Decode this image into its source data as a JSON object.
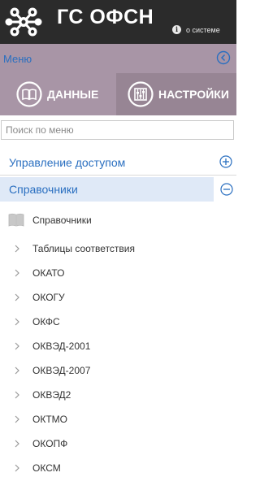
{
  "header": {
    "app_title": "ГС ОФСН",
    "about_label": "о системе"
  },
  "menu_bar": {
    "label": "Меню"
  },
  "tabs": [
    {
      "label": "ДАННЫЕ",
      "active": false
    },
    {
      "label": "НАСТРОЙКИ",
      "active": true
    }
  ],
  "search": {
    "placeholder": "Поиск по меню",
    "value": ""
  },
  "sections": [
    {
      "label": "Управление доступом",
      "expanded": false
    },
    {
      "label": "Справочники",
      "expanded": true
    }
  ],
  "tree": {
    "root_label": "Справочники",
    "items": [
      "Таблицы соответствия",
      "ОКАТО",
      "ОКОГУ",
      "ОКФС",
      "ОКВЭД-2001",
      "ОКВЭД-2007",
      "ОКВЭД2",
      "ОКТМО",
      "ОКОПФ",
      "ОКСМ"
    ]
  },
  "colors": {
    "header_bg": "#2b2b2b",
    "menu_bg": "#a895a6",
    "active_tab_bg": "#978594",
    "link": "#2a6fc0",
    "selected_section_bg": "#dfe9f7"
  },
  "icons": {
    "logo": "molecule-logo-icon",
    "about": "info-icon",
    "collapse": "chevron-left-circle-icon",
    "tab_data": "open-book-circle-icon",
    "tab_settings": "sliders-circle-icon",
    "expand": "plus-circle-icon",
    "collapse_section": "minus-circle-icon",
    "tree_root": "book-icon",
    "tree_item": "chevron-right-icon"
  }
}
